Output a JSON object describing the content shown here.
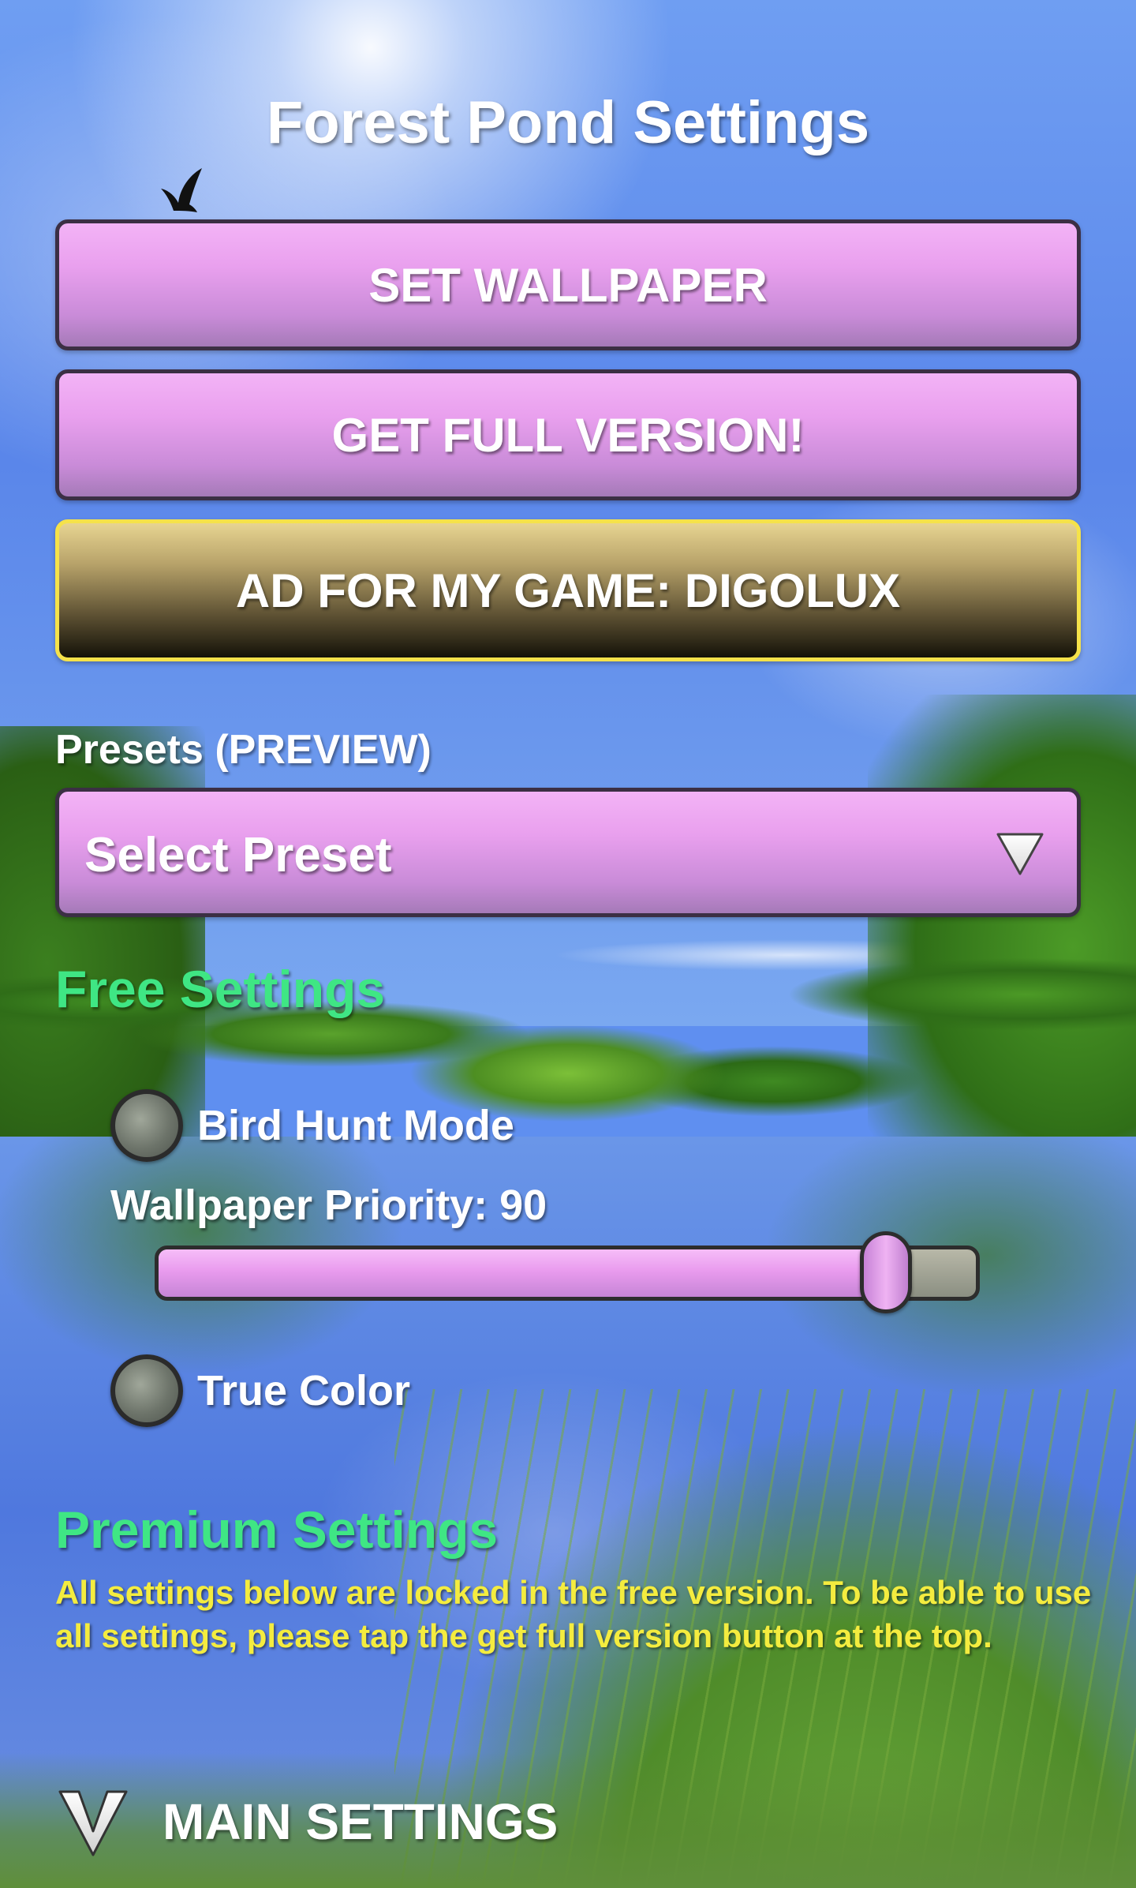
{
  "page": {
    "title": "Forest Pond Settings"
  },
  "buttons": {
    "set_wallpaper": "SET WALLPAPER",
    "get_full_version": "GET FULL VERSION!",
    "ad": "AD FOR MY GAME: DIGOLUX"
  },
  "presets": {
    "label": "Presets (PREVIEW)",
    "select_value": "Select Preset"
  },
  "free_settings": {
    "heading": "Free Settings",
    "bird_hunt_mode": {
      "label": "Bird Hunt Mode",
      "checked": false
    },
    "wallpaper_priority": {
      "label": "Wallpaper Priority: 90",
      "value": 90,
      "max": 100
    },
    "true_color": {
      "label": "True Color",
      "checked": false
    }
  },
  "premium_settings": {
    "heading": "Premium Settings",
    "note": "All settings below are locked in the free version. To be able to use all settings, please tap the get full version button at the top."
  },
  "main_settings": {
    "label": "MAIN SETTINGS"
  },
  "icons": {
    "bird": "bird-icon",
    "select_chevron": "chevron-down-icon",
    "expand": "expand-chevron-icon"
  },
  "colors": {
    "button_purple": "#e9a0ee",
    "ad_border": "#f5e24a",
    "green_heading": "#3fe684",
    "premium_note": "#f4ec3f"
  }
}
